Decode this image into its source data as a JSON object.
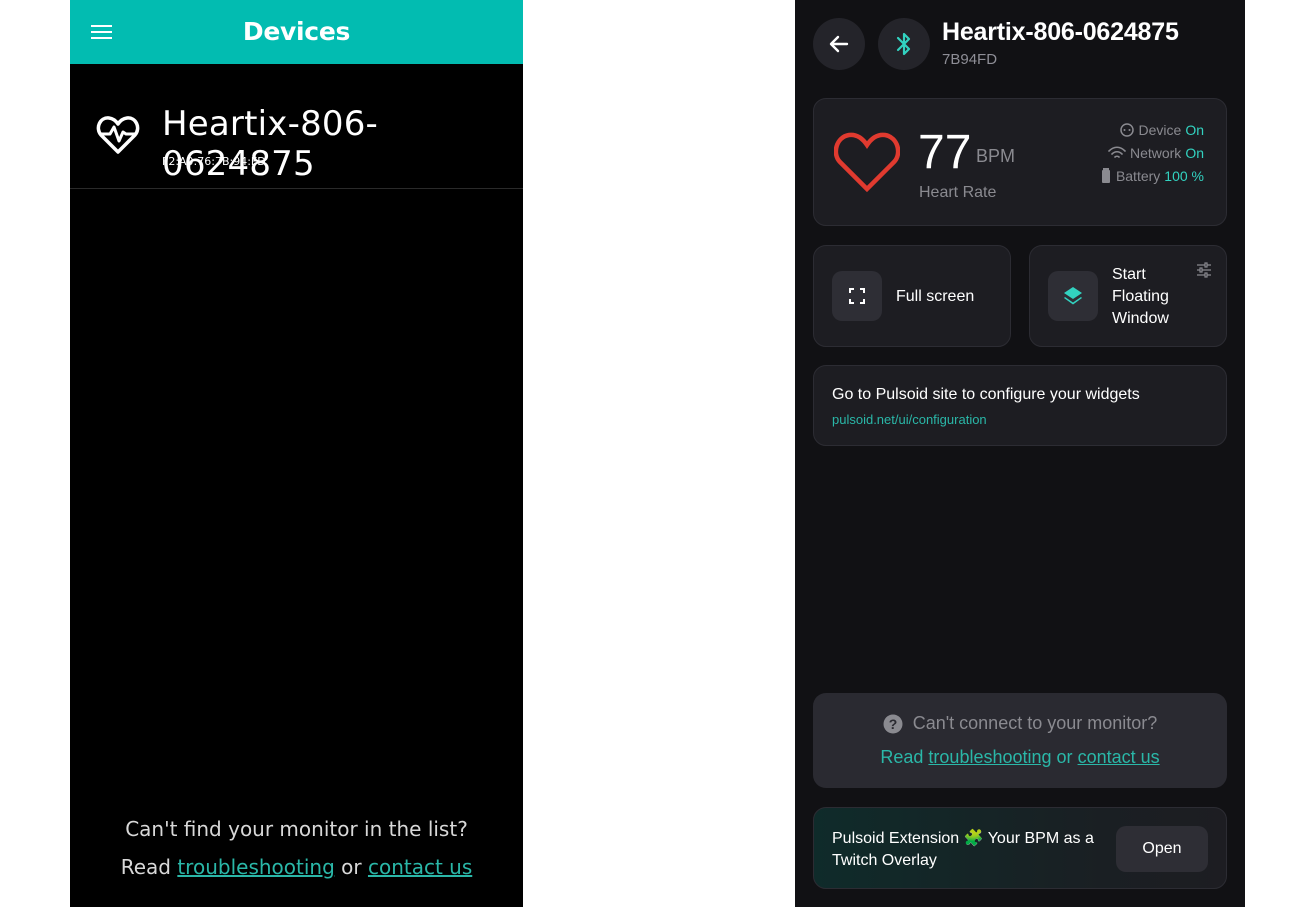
{
  "left_screen": {
    "appbar": {
      "title": "Devices",
      "menu_icon": "hamburger-menu-icon",
      "color": "#02bcb1"
    },
    "device": {
      "name": "Heartix-806-0624875",
      "mac": "F2:A0:76:7B:94:FD",
      "icon": "heart-pulse-icon"
    },
    "footer": {
      "question": "Can't find your monitor in the list?",
      "read": "Read",
      "troubleshooting": "troubleshooting",
      "or": "or",
      "contact": "contact us"
    }
  },
  "right_screen": {
    "header": {
      "title": "Heartix-806-0624875",
      "subtitle": "7B94FD",
      "back_icon": "arrow-left-icon",
      "bluetooth_icon": "bluetooth-icon"
    },
    "heart_rate": {
      "value": "77",
      "unit": "BPM",
      "label": "Heart Rate",
      "icon": "heart-icon",
      "accent": "#e03a2f"
    },
    "status": [
      {
        "label": "Device",
        "value": "On",
        "icon": "device-icon"
      },
      {
        "label": "Network",
        "value": "On",
        "icon": "wifi-icon"
      },
      {
        "label": "Battery",
        "value": "100 %",
        "icon": "battery-icon"
      }
    ],
    "actions": {
      "fullscreen": {
        "label": "Full screen",
        "icon": "fullscreen-icon"
      },
      "floating": {
        "line1": "Start",
        "line2": "Floating",
        "line3": "Window",
        "icon": "layers-icon",
        "settings_icon": "tune-icon"
      }
    },
    "configure": {
      "title": "Go to Pulsoid site to configure your widgets",
      "link": "pulsoid.net/ui/configuration"
    },
    "help": {
      "question": "Can't connect to your monitor?",
      "read": "Read",
      "troubleshooting": "troubleshooting",
      "or": "or",
      "contact": "contact us",
      "icon": "question-circle-icon"
    },
    "extension": {
      "text": "Pulsoid Extension 🧩 Your BPM as a Twitch Overlay",
      "button": "Open"
    },
    "accent_color": "#32d2c0"
  }
}
